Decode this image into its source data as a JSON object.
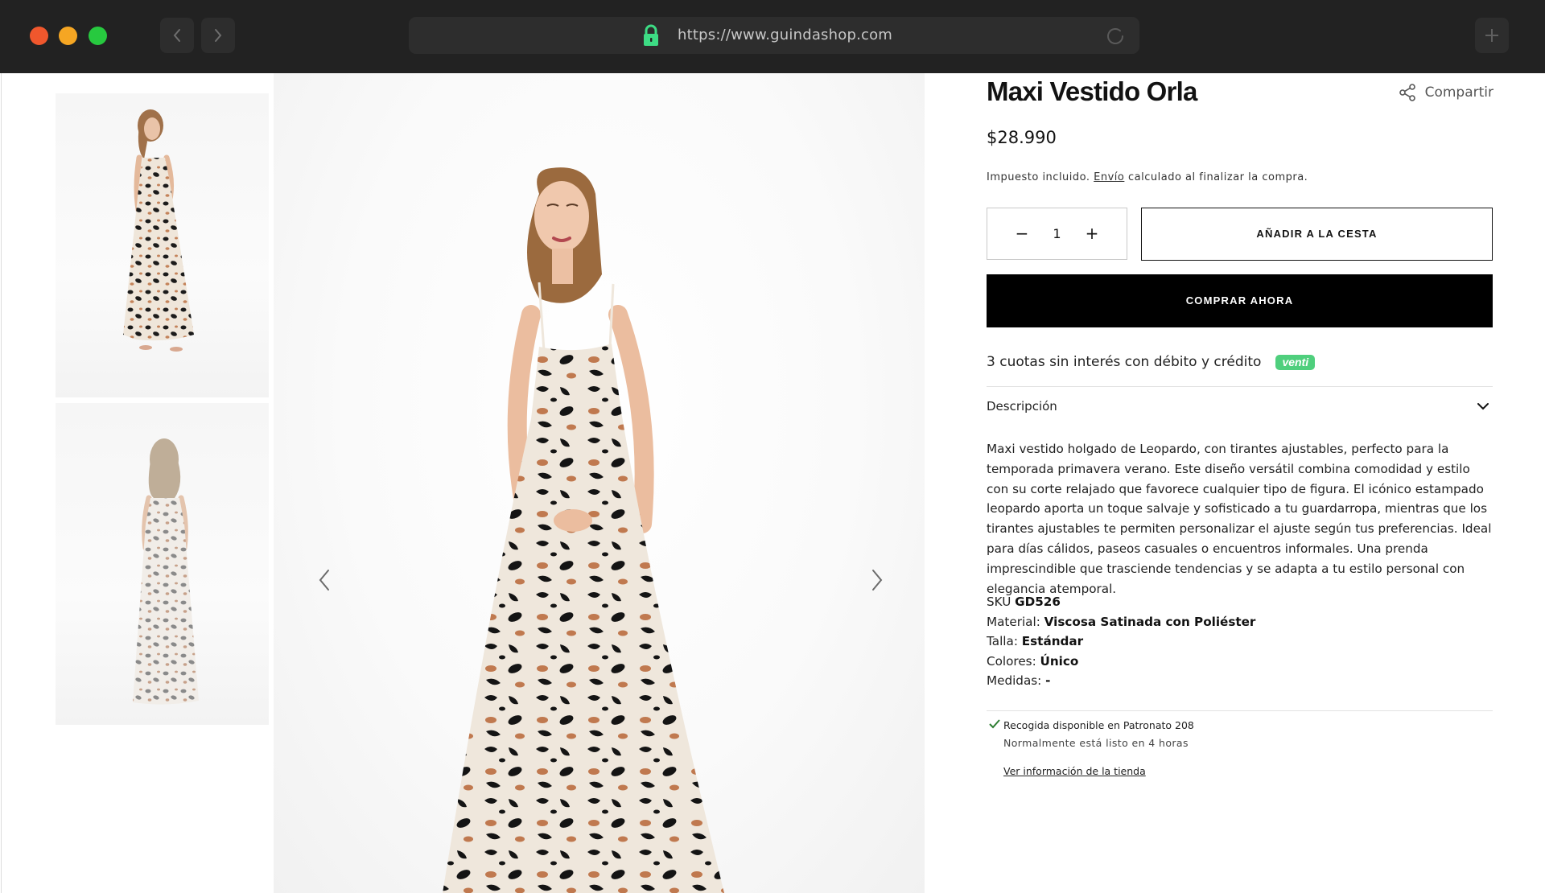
{
  "browser": {
    "url": "https://www.guindashop.com",
    "icons": [
      "back-icon",
      "forward-icon",
      "lock-icon",
      "reload-icon",
      "new-tab-icon"
    ]
  },
  "gallery": {
    "thumbnails": [
      "leopard-dress-front-thumbnail",
      "leopard-dress-back-thumbnail"
    ],
    "main_image": "leopard-maxi-dress-photo"
  },
  "product": {
    "title": "Maxi Vestido Orla",
    "share_label": "Compartir",
    "price": "$28.990",
    "tax_prefix": "Impuesto incluido.",
    "tax_link": "Envío",
    "tax_suffix": "calculado al finalizar la compra.",
    "quantity": "1",
    "quantity_minus": "−",
    "quantity_plus": "+",
    "add_to_cart": "AÑADIR A LA CESTA",
    "buy_now": "COMPRAR AHORA",
    "installments": "3 cuotas sin interés con débito y crédito",
    "installments_badge": "venti",
    "description_label": "Descripción",
    "description": "Maxi vestido holgado de Leopardo, con tirantes ajustables, perfecto para la temporada primavera verano. Este diseño versátil combina comodidad y estilo con su corte relajado que favorece cualquier tipo de figura. El icónico estampado leopardo aporta un toque salvaje y sofisticado a tu guardarropa, mientras que los tirantes ajustables te permiten personalizar el ajuste según tus preferencias. Ideal para días cálidos, paseos casuales o encuentros informales. Una prenda imprescindible que trasciende tendencias y se adapta a tu estilo personal con elegancia atemporal.",
    "specs": {
      "sku_label": "SKU",
      "sku_value": "GD526",
      "material_label": "Material:",
      "material_value": "Viscosa Satinada con Poliéster",
      "talla_label": "Talla:",
      "talla_value": "Estándar",
      "colores_label": "Colores:",
      "colores_value": "Único",
      "medidas_label": "Medidas:",
      "medidas_value": "-"
    },
    "pickup": {
      "available": "Recogida disponible en Patronato 208",
      "ready": "Normalmente está listo en 4 horas",
      "store_link": "Ver información de la tienda"
    }
  },
  "colors": {
    "chrome_bg": "#222222",
    "buy_now_bg": "#000000",
    "venti_badge": "#4fcf7d",
    "lock_green": "#3ddc84"
  }
}
